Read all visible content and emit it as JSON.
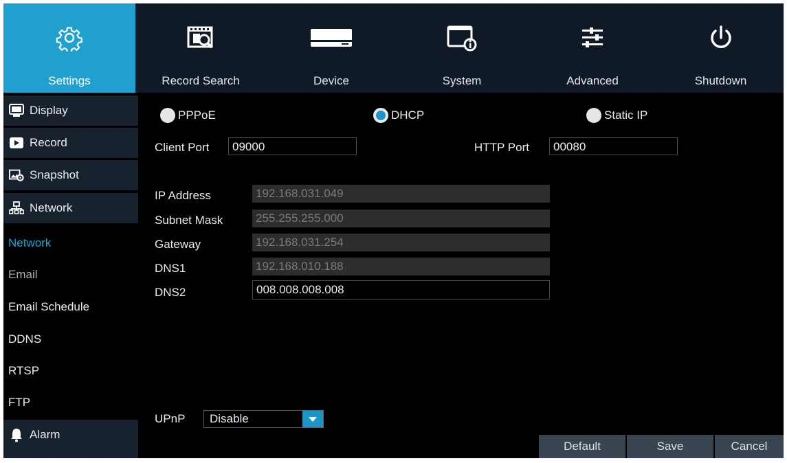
{
  "topnav": {
    "tabs": [
      {
        "label": "Settings",
        "icon": "gear-icon",
        "active": true
      },
      {
        "label": "Record Search",
        "icon": "record-search-icon"
      },
      {
        "label": "Device",
        "icon": "hard-drive-icon"
      },
      {
        "label": "System",
        "icon": "system-info-icon"
      },
      {
        "label": "Advanced",
        "icon": "sliders-icon"
      },
      {
        "label": "Shutdown",
        "icon": "power-icon"
      }
    ]
  },
  "sidebar": {
    "display": "Display",
    "record": "Record",
    "snapshot": "Snapshot",
    "network": "Network",
    "sub": {
      "network": "Network",
      "email": "Email",
      "email_schedule": "Email Schedule",
      "ddns": "DDNS",
      "rtsp": "RTSP",
      "ftp": "FTP"
    },
    "alarm": "Alarm"
  },
  "network": {
    "mode": {
      "pppoe": "PPPoE",
      "dhcp": "DHCP",
      "static_ip": "Static IP",
      "selected": "DHCP"
    },
    "client_port_label": "Client Port",
    "client_port": "09000",
    "http_port_label": "HTTP Port",
    "http_port": "00080",
    "ip_address_label": "IP Address",
    "ip_address": "192.168.031.049",
    "subnet_mask_label": "Subnet Mask",
    "subnet_mask": "255.255.255.000",
    "gateway_label": "Gateway",
    "gateway": "192.168.031.254",
    "dns1_label": "DNS1",
    "dns1": "192.168.010.188",
    "dns2_label": "DNS2",
    "dns2": "008.008.008.008",
    "upnp_label": "UPnP",
    "upnp_value": "Disable"
  },
  "buttons": {
    "default": "Default",
    "save": "Save",
    "cancel": "Cancel"
  },
  "colors": {
    "accent": "#1fa0cf",
    "nav_bg": "#0f1a26",
    "button_bg": "#3a4552"
  }
}
